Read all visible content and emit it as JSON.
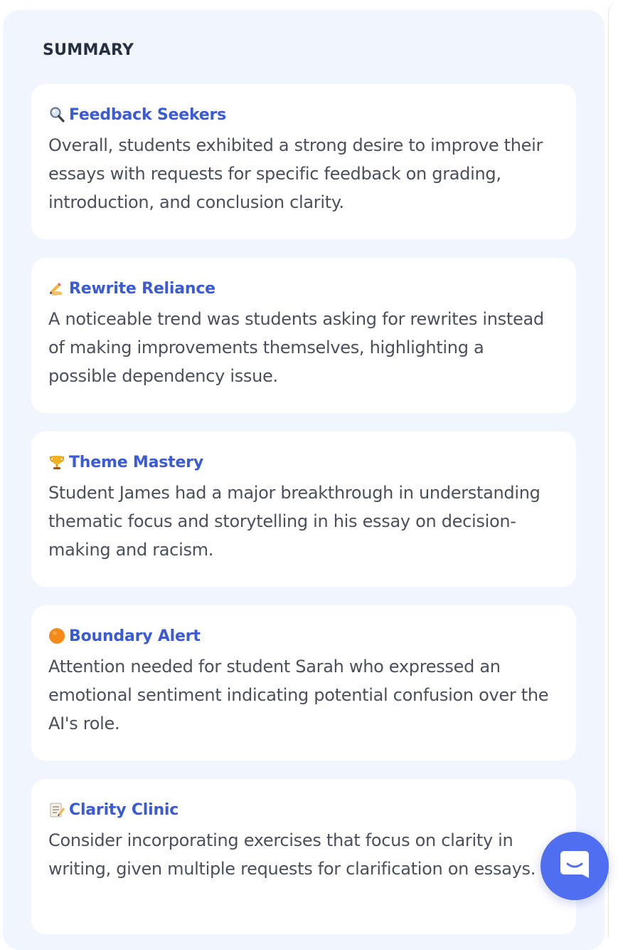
{
  "summary": {
    "heading": "SUMMARY",
    "cards": [
      {
        "icon": "magnifying-glass-icon",
        "title": "Feedback Seekers",
        "body": "Overall, students exhibited a strong desire to improve their essays with requests for specific feedback on grading, introduction, and conclusion clarity."
      },
      {
        "icon": "writing-hand-icon",
        "title": "Rewrite Reliance",
        "body": "A noticeable trend was students asking for rewrites instead of making improvements themselves, highlighting a possible dependency issue."
      },
      {
        "icon": "trophy-icon",
        "title": "Theme Mastery",
        "body": "Student James had a major breakthrough in understanding thematic focus and storytelling in his essay on decision-making and racism."
      },
      {
        "icon": "orange-circle-icon",
        "title": "Boundary Alert",
        "body": "Attention needed for student Sarah who expressed an emotional sentiment indicating potential confusion over the AI's role."
      },
      {
        "icon": "memo-icon",
        "title": "Clarity Clinic",
        "body": "Consider incorporating exercises that focus on clarity in writing, given multiple requests for clarification on essays."
      }
    ]
  },
  "colors": {
    "panel_background": "#f1f5fe",
    "card_background": "#ffffff",
    "title_accent": "#3b5bd6",
    "body_text": "#4a4f5b",
    "launcher": "#4f6ff0"
  },
  "chat_launcher": {
    "icon": "chat-bubble-icon"
  }
}
